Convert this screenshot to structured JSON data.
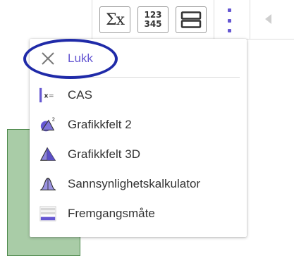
{
  "toolbar": {
    "cas_button_label": "Σx",
    "numbers_top": "123",
    "numbers_bottom": "345"
  },
  "menu": {
    "close_label": "Lukk",
    "items": [
      {
        "label": "CAS",
        "icon": "cas-icon"
      },
      {
        "label": "Grafikkfelt 2",
        "icon": "graphics-2-icon"
      },
      {
        "label": "Grafikkfelt 3D",
        "icon": "graphics-3d-icon"
      },
      {
        "label": "Sannsynlighetskalkulator",
        "icon": "probability-calculator-icon"
      },
      {
        "label": "Fremgangsmåte",
        "icon": "construction-protocol-icon"
      }
    ]
  },
  "colors": {
    "accent": "#6557d2",
    "highlight_oval": "#1f2aa8",
    "graphics_rect": "#a9cca7"
  }
}
